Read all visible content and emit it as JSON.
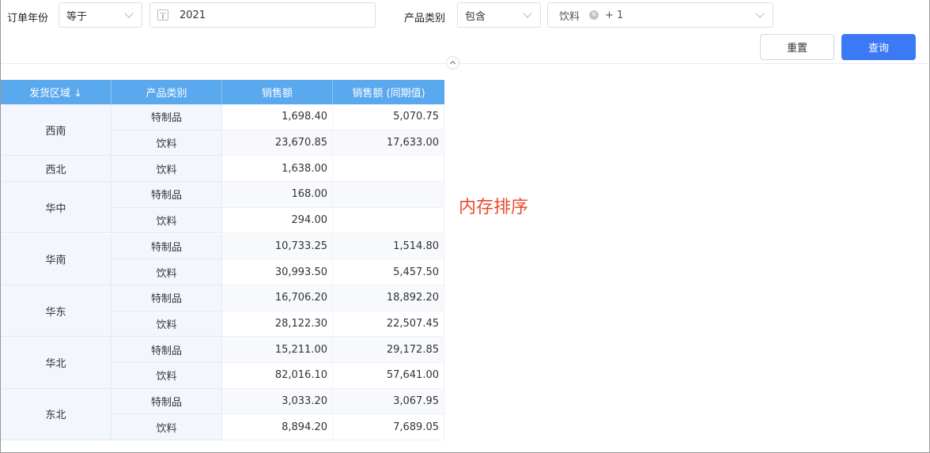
{
  "filters": {
    "order_year_label": "订单年份",
    "order_year_operator": "等于",
    "order_year_value": "2021",
    "category_label": "产品类别",
    "category_operator": "包含",
    "category_tag": "饮料",
    "category_more": "+ 1"
  },
  "buttons": {
    "reset": "重置",
    "query": "查询"
  },
  "table": {
    "headers": [
      "发货区域 ↓",
      "产品类别",
      "销售额",
      "销售额 (同期值)"
    ],
    "groups": [
      {
        "region": "西南",
        "rows": [
          {
            "cat": "特制品",
            "sales": "1,698.40",
            "prev": "5,070.75"
          },
          {
            "cat": "饮料",
            "sales": "23,670.85",
            "prev": "17,633.00"
          }
        ]
      },
      {
        "region": "西北",
        "rows": [
          {
            "cat": "饮料",
            "sales": "1,638.00",
            "prev": ""
          }
        ]
      },
      {
        "region": "华中",
        "rows": [
          {
            "cat": "特制品",
            "sales": "168.00",
            "prev": ""
          },
          {
            "cat": "饮料",
            "sales": "294.00",
            "prev": ""
          }
        ]
      },
      {
        "region": "华南",
        "rows": [
          {
            "cat": "特制品",
            "sales": "10,733.25",
            "prev": "1,514.80"
          },
          {
            "cat": "饮料",
            "sales": "30,993.50",
            "prev": "5,457.50"
          }
        ]
      },
      {
        "region": "华东",
        "rows": [
          {
            "cat": "特制品",
            "sales": "16,706.20",
            "prev": "18,892.20"
          },
          {
            "cat": "饮料",
            "sales": "28,122.30",
            "prev": "22,507.45"
          }
        ]
      },
      {
        "region": "华北",
        "rows": [
          {
            "cat": "特制品",
            "sales": "15,211.00",
            "prev": "29,172.85"
          },
          {
            "cat": "饮料",
            "sales": "82,016.10",
            "prev": "57,641.00"
          }
        ]
      },
      {
        "region": "东北",
        "rows": [
          {
            "cat": "特制品",
            "sales": "3,033.20",
            "prev": "3,067.95"
          },
          {
            "cat": "饮料",
            "sales": "8,894.20",
            "prev": "7,689.05"
          }
        ]
      }
    ]
  },
  "annotation": "内存排序"
}
